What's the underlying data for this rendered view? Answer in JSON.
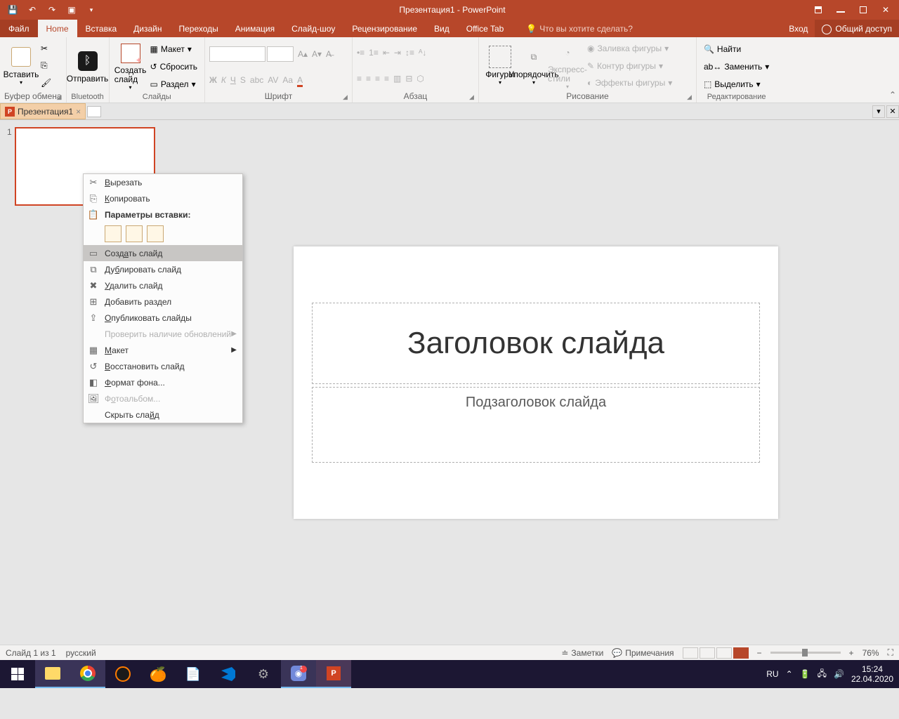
{
  "titlebar": {
    "title": "Презентация1 - PowerPoint"
  },
  "tabs": {
    "file": "Файл",
    "home": "Home",
    "insert": "Вставка",
    "design": "Дизайн",
    "transitions": "Переходы",
    "animations": "Анимация",
    "slideshow": "Слайд-шоу",
    "review": "Рецензирование",
    "view": "Вид",
    "officetab": "Office Tab",
    "tellme": "Что вы хотите сделать?",
    "login": "Вход",
    "share": "Общий доступ"
  },
  "ribbon": {
    "clipboard": {
      "paste": "Вставить",
      "label": "Буфер обмена"
    },
    "bluetooth": {
      "send": "Отправить",
      "label": "Bluetooth"
    },
    "slides": {
      "new": "Создать слайд",
      "layout": "Макет",
      "reset": "Сбросить",
      "section": "Раздел",
      "label": "Слайды"
    },
    "font": {
      "label": "Шрифт"
    },
    "paragraph": {
      "label": "Абзац"
    },
    "drawing": {
      "shapes": "Фигуры",
      "arrange": "Упорядочить",
      "styles": "Экспресс-стили",
      "fill": "Заливка фигуры",
      "outline": "Контур фигуры",
      "effects": "Эффекты фигуры",
      "label": "Рисование"
    },
    "editing": {
      "find": "Найти",
      "replace": "Заменить",
      "select": "Выделить",
      "label": "Редактирование"
    }
  },
  "docTab": {
    "name": "Презентация1"
  },
  "thumb": {
    "num": "1"
  },
  "slide": {
    "title": "Заголовок слайда",
    "subtitle": "Подзаголовок слайда"
  },
  "contextMenu": {
    "cut": "Вырезать",
    "copy": "Копировать",
    "pasteOptions": "Параметры вставки:",
    "newSlide": "Создать слайд",
    "duplicate": "Дублировать слайд",
    "delete": "Удалить слайд",
    "addSection": "Добавить раздел",
    "publish": "Опубликовать слайды",
    "checkUpdates": "Проверить наличие обновлений",
    "layout": "Макет",
    "restore": "Восстановить слайд",
    "formatBg": "Формат фона...",
    "photoAlbum": "Фотоальбом...",
    "hide": "Скрыть слайд"
  },
  "statusbar": {
    "slideInfo": "Слайд 1 из 1",
    "lang": "русский",
    "notes": "Заметки",
    "comments": "Примечания",
    "zoom": "76%"
  },
  "tray": {
    "lang": "RU",
    "time": "15:24",
    "date": "22.04.2020"
  }
}
